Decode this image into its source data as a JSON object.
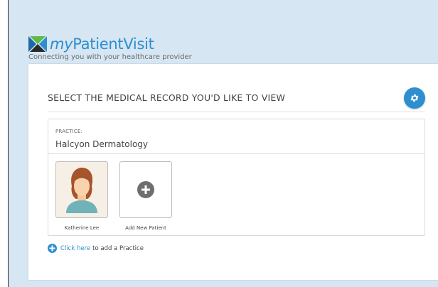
{
  "header": {
    "brand_prefix": "my",
    "brand_suffix": "PatientVisit",
    "tagline": "Connecting you with your healthcare provider"
  },
  "main": {
    "title": "SELECT THE MEDICAL RECORD YOU'D LIKE TO VIEW",
    "settings_icon": "gear-icon",
    "practice": {
      "label": "PRACTICE:",
      "name": "Halcyon Dermatology",
      "patients": [
        {
          "name": "Katherine Lee",
          "icon": "patient-avatar-icon"
        }
      ],
      "add_patient_label": "Add New Patient"
    },
    "add_practice": {
      "link_text": "Click here",
      "text": "to add a Practice"
    }
  },
  "colors": {
    "accent": "#2d8fcf",
    "page_background": "#d6e6f3",
    "card_background": "#ffffff"
  }
}
